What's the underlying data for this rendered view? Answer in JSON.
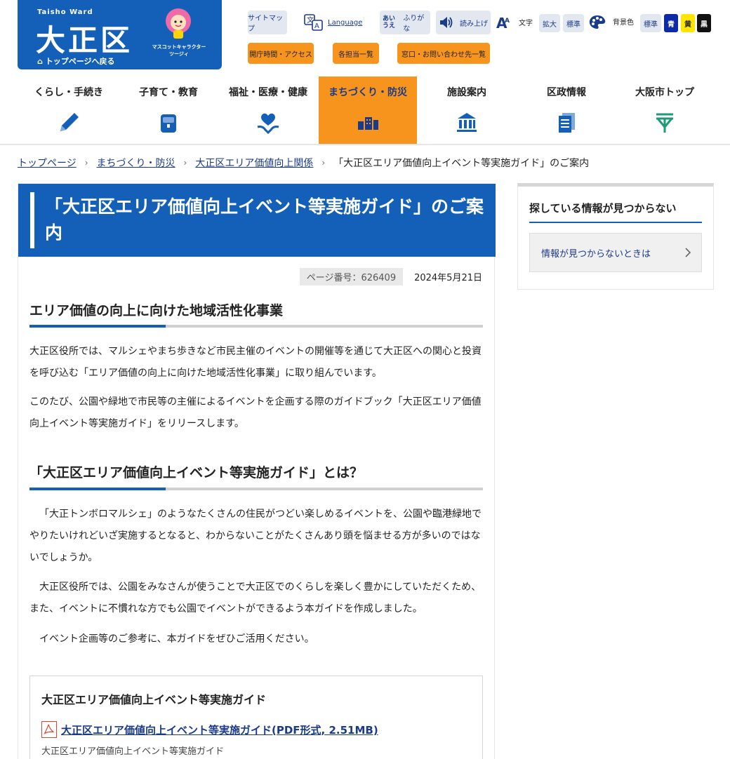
{
  "logo": {
    "en": "Taisho Ward",
    "jp": "大正区",
    "top_link": "トップページへ戻る",
    "mascot_caption_1": "マスコットキャラクター",
    "mascot_caption_2": "ツージィ"
  },
  "utility": {
    "sitemap": "サイトマップ",
    "language": "Language",
    "furigana_icon": "あい うえ",
    "furigana": "ふりがな",
    "read_aloud": "読み上げ",
    "text_size_label": "文字",
    "enlarge": "拡大",
    "standard": "標準",
    "bg_label": "背景色",
    "bg_standard": "標準",
    "bg_blue": "青",
    "bg_yellow": "黄",
    "bg_black": "黒"
  },
  "quick_links": {
    "hours": "開庁時間・アクセス",
    "sections": "各担当一覧",
    "contact": "窓口・お問い合わせ先一覧"
  },
  "gnav": {
    "items": [
      {
        "label": "くらし・手続き",
        "icon": "pencil-icon"
      },
      {
        "label": "子育て・教育",
        "icon": "school-bag-icon"
      },
      {
        "label": "福祉・医療・健康",
        "icon": "heart-hands-icon"
      },
      {
        "label": "まちづくり・防災",
        "icon": "town-icon"
      },
      {
        "label": "施設案内",
        "icon": "building-icon"
      },
      {
        "label": "区政情報",
        "icon": "documents-icon"
      },
      {
        "label": "大阪市トップ",
        "icon": "osaka-mark-icon"
      }
    ]
  },
  "breadcrumb": {
    "home": "トップページ",
    "level1": "まちづくり・防災",
    "level2": "大正区エリア価値向上関係",
    "current": "「大正区エリア価値向上イベント等実施ガイド」のご案内"
  },
  "article": {
    "title": "「大正区エリア価値向上イベント等実施ガイド」のご案内",
    "page_number": "ページ番号：626409",
    "date": "2024年5月21日",
    "section1_heading": "エリア価値の向上に向けた地域活性化事業",
    "section1_p1": "大正区役所では、マルシェやまち歩きなど市民主催のイベントの開催等を通じて大正区への関心と投資を呼び込む「エリア価値の向上に向けた地域活性化事業」に取り組んでいます。",
    "section1_p2": "このたび、公園や緑地で市民等の主催によるイベントを企画する際のガイドブック「大正区エリア価値向上イベント等実施ガイド」をリリースします。",
    "section2_heading": "「大正区エリア価値向上イベント等実施ガイド」とは？",
    "section2_p1": "「大正トンボロマルシェ」のようなたくさんの住民がつどい楽しめるイベントを、公園や臨港緑地でやりたいけれどいざ実施するとなると、わからないことがたくさんあり頭を悩ませる方が多いのではないでしょうか。",
    "section2_p2": "大正区役所では、公園をみなさんが使うことで大正区でのくらしを楽しく豊かにしていただくため、また、イベントに不慣れな方でも公園でイベントができるよう本ガイドを作成しました。",
    "section2_p3": "イベント企画等のご参考に、本ガイドをぜひご活用ください。",
    "download_title": "大正区エリア価値向上イベント等実施ガイド",
    "download_link": "大正区エリア価値向上イベント等実施ガイド(PDF形式, 2.51MB)",
    "download_desc": "大正区エリア価値向上イベント等実施ガイド"
  },
  "side": {
    "title": "探している情報が見つからない",
    "button": "情報が見つからないときは"
  },
  "colors": {
    "brand_blue": "#1460b8",
    "accent_orange": "#f7941d",
    "link": "#1a3a8a"
  }
}
